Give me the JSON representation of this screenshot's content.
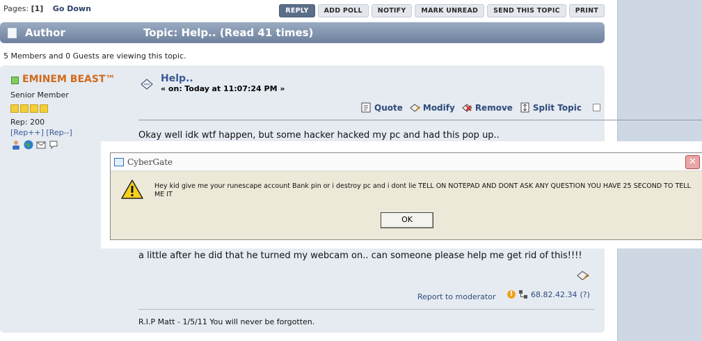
{
  "pagination": {
    "label": "Pages:",
    "current": "[1]",
    "go_down": "Go Down"
  },
  "buttons": {
    "reply": "REPLY",
    "add_poll": "ADD POLL",
    "notify": "NOTIFY",
    "mark_unread": "MARK UNREAD",
    "send_topic": "SEND THIS TOPIC",
    "print": "PRINT"
  },
  "topic_bar": {
    "author": "Author",
    "title": "Topic: Help..  (Read 41 times)"
  },
  "viewing": "5 Members and 0 Guests are viewing this topic.",
  "poster": {
    "name": "EMINEM BEAST™",
    "rank": "Senior Member",
    "stars": 4,
    "rep": "Rep: 200",
    "rep_plus": "[Rep++]",
    "rep_minus": "[Rep--]",
    "status": "online",
    "name_color": "#d06a1c"
  },
  "post": {
    "subject": "Help..",
    "date_prefix": "« on:",
    "date_day": "Today",
    "date_time": "at 11:07:24 PM »",
    "actions": {
      "quote": "Quote",
      "modify": "Modify",
      "remove": "Remove",
      "split": "Split Topic"
    },
    "body_line1": "Okay well idk wtf happen, but some hacker hacked my pc and had this pop up..",
    "body_line2": "a little after he did that he turned my webcam on.. can someone please help me get rid of this!!!!",
    "report": "Report to moderator",
    "ip": "68.82.42.34",
    "ip_help": "(?)",
    "signature": "R.I.P Matt - 1/5/11 You will never be forgotten."
  },
  "dialog": {
    "title": "CyberGate",
    "close": "✕",
    "message": "Hey kid give me your runescape account Bank pin or i destroy pc and i dont lie TELL ON NOTEPAD AND DONT ASK ANY QUESTION YOU HAVE 25 SECOND TO TELL ME IT",
    "ok": "OK"
  },
  "colors": {
    "accent": "#3a5896",
    "topic_bar": "#7f91ab",
    "post_bg": "#e6ebf2",
    "dialog_bg": "#ece9d8"
  }
}
